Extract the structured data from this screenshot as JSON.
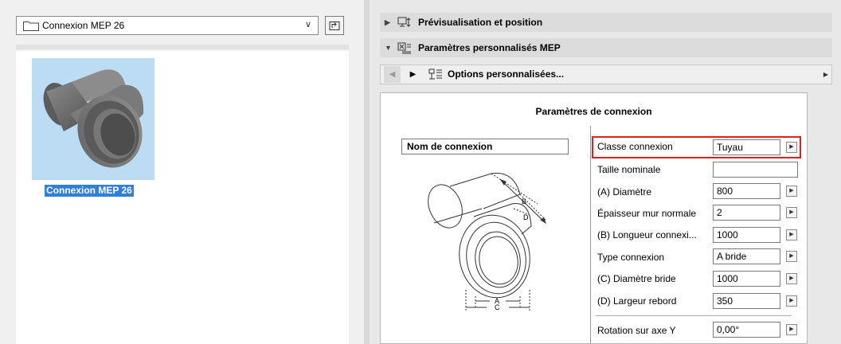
{
  "library": {
    "selected_folder": "Connexion MEP 26",
    "items": [
      {
        "label": "Connexion MEP 26"
      }
    ]
  },
  "panels": {
    "preview_header": "Prévisualisation et position",
    "mep_header": "Paramètres personnalisés MEP",
    "options_label": "Options personnalisées..."
  },
  "connection": {
    "title": "Paramètres de connexion",
    "name_label": "Nom de connexion",
    "params": [
      {
        "label": "Classe connexion",
        "value": "Tuyau"
      },
      {
        "label": "Taille nominale",
        "value": ""
      },
      {
        "label": "(A) Diamètre",
        "value": "800"
      },
      {
        "label": "Épaisseur mur normale",
        "value": "2"
      },
      {
        "label": "(B) Longueur connexi...",
        "value": "1000"
      },
      {
        "label": "Type connexion",
        "value": "A bride"
      },
      {
        "label": "(C) Diamètre bride",
        "value": "1000"
      },
      {
        "label": "(D) Largeur rebord",
        "value": "350"
      },
      {
        "label": "Rotation sur axe Y",
        "value": "0,00°"
      }
    ],
    "diagram_labels": {
      "a": "A",
      "b": "B",
      "c": "C",
      "d": "D"
    }
  },
  "colors": {
    "highlight": "#e02020",
    "selection": "#2f7fde",
    "thumb_bg": "#bcdcf4"
  }
}
